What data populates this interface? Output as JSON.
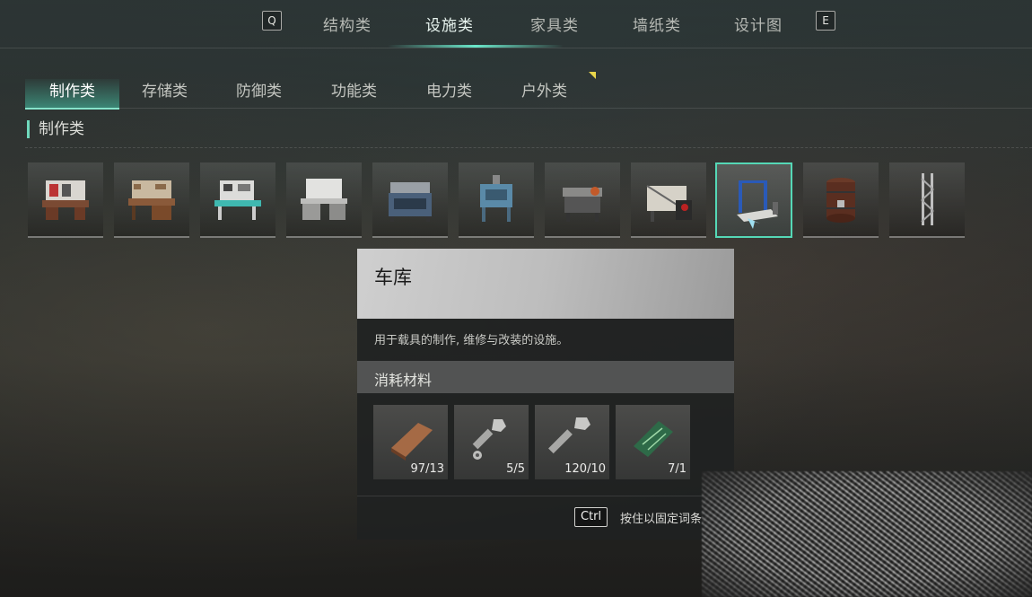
{
  "top_nav": {
    "left_key": "Q",
    "right_key": "E",
    "tabs": [
      {
        "label": "结构类"
      },
      {
        "label": "设施类"
      },
      {
        "label": "家具类"
      },
      {
        "label": "墙纸类"
      },
      {
        "label": "设计图"
      }
    ],
    "active_tab": "设施类"
  },
  "sub_nav": {
    "tabs": [
      {
        "label": "制作类"
      },
      {
        "label": "存储类"
      },
      {
        "label": "防御类"
      },
      {
        "label": "功能类"
      },
      {
        "label": "电力类"
      },
      {
        "label": "户外类"
      }
    ],
    "active_tab": "制作类"
  },
  "section": {
    "title": "制作类"
  },
  "items": [
    {
      "icon": "workbench-red-icon"
    },
    {
      "icon": "workbench-desk-icon"
    },
    {
      "icon": "workbench-electronics-icon"
    },
    {
      "icon": "workbench-metal-icon"
    },
    {
      "icon": "stove-icon"
    },
    {
      "icon": "furnace-icon"
    },
    {
      "icon": "machine-bench-icon"
    },
    {
      "icon": "loom-icon"
    },
    {
      "icon": "garage-lift-icon"
    },
    {
      "icon": "barrel-icon"
    },
    {
      "icon": "tower-scaffold-icon"
    }
  ],
  "selected_item_index": 8,
  "tooltip": {
    "name": "车库",
    "description": "用于载具的制作, 维修与改装的设施。",
    "materials_label": "消耗材料",
    "materials": [
      {
        "icon": "copper-ingot-icon",
        "count": "97/13"
      },
      {
        "icon": "bolt-nut-icon",
        "count": "5/5"
      },
      {
        "icon": "screw-icon",
        "count": "120/10"
      },
      {
        "icon": "circuit-board-icon",
        "count": "7/1"
      }
    ],
    "hint_key": "Ctrl",
    "hint_text": "按住以固定词条"
  },
  "colors": {
    "accent": "#55d8b6",
    "tab_highlight": "#7fe6cb",
    "new_marker": "#e8d54a"
  }
}
